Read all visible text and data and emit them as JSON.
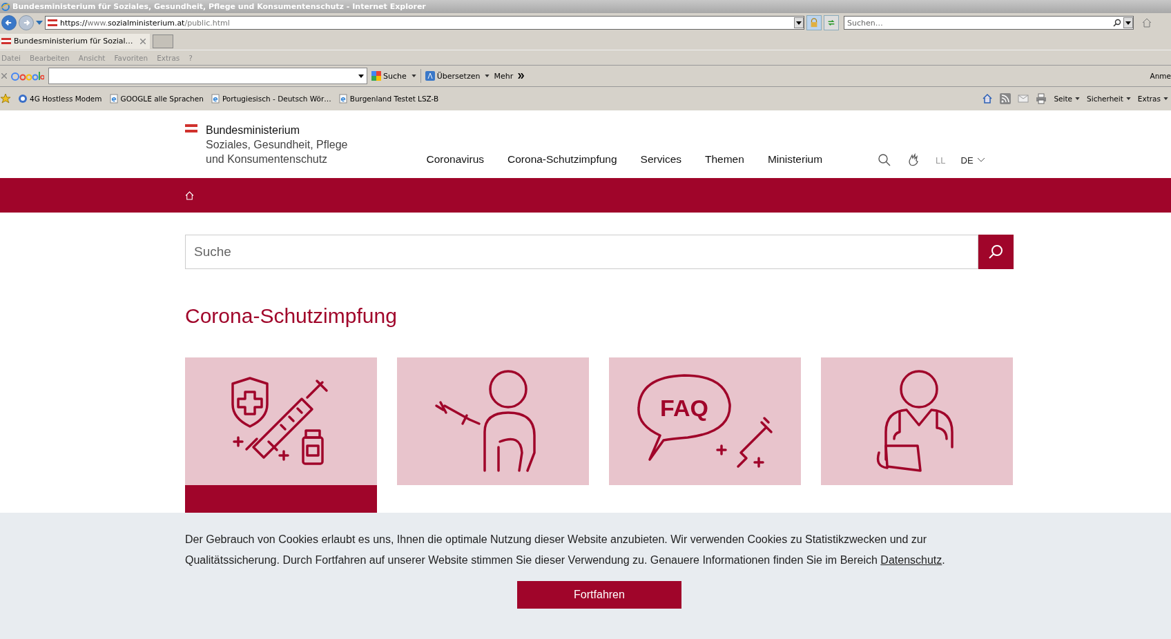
{
  "browser": {
    "title": "Bundesministerium für Soziales, Gesundheit, Pflege und Konsumentenschutz - Internet Explorer",
    "address": [
      {
        "text": "https://",
        "dim": false
      },
      {
        "text": "www.",
        "dim": true
      },
      {
        "text": "sozialministerium.at",
        "dim": false
      },
      {
        "text": "/public.html",
        "dim": true
      }
    ],
    "search_placeholder": "Suchen…",
    "tabs": [
      {
        "label": "Bundesministerium für Sozial…",
        "selected": true
      }
    ],
    "menu": [
      "Datei",
      "Bearbeiten",
      "Ansicht",
      "Favoriten",
      "Extras",
      "?"
    ],
    "google_bar": {
      "search": "Suche",
      "translate": "Übersetzen",
      "more": "Mehr",
      "right": "Anme"
    },
    "favorites": [
      {
        "label": "4G Hostless Modem",
        "kind": "globe"
      },
      {
        "label": "GOOGLE alle Sprachen",
        "kind": "page"
      },
      {
        "label": "Portugiesisch - Deutsch Wör…",
        "kind": "page"
      },
      {
        "label": "Burgenland Testet  LSZ-B",
        "kind": "page"
      }
    ],
    "commands": [
      "Seite",
      "Sicherheit",
      "Extras"
    ]
  },
  "site": {
    "logo": [
      "Bundesministerium",
      "Soziales, Gesundheit, Pflege",
      "und Konsumentenschutz"
    ],
    "nav": [
      "Coronavirus",
      "Corona-Schutzimpfung",
      "Services",
      "Themen",
      "Ministerium"
    ],
    "easy_language": "LL",
    "language": "DE",
    "search": {
      "placeholder": "Suche"
    },
    "heading": "Corona-Schutzimpfung",
    "cards": [
      {
        "kind": "shield-syringe",
        "highlighted": true
      },
      {
        "kind": "person-syringe",
        "highlighted": false
      },
      {
        "kind": "faq",
        "label": "FAQ",
        "highlighted": false
      },
      {
        "kind": "doctor",
        "highlighted": false
      }
    ]
  },
  "cookie": {
    "text": "Der Gebrauch von Cookies erlaubt es uns, Ihnen die optimale Nutzung dieser Website anzubieten. Wir verwenden Cookies zu Statistikzwecken und zur Qualitätssicherung. Durch Fortfahren auf unserer Website stimmen Sie dieser Verwendung zu. Genauere Informationen finden Sie im Bereich ",
    "link": "Datenschutz",
    "after": ".",
    "button": "Fortfahren"
  }
}
